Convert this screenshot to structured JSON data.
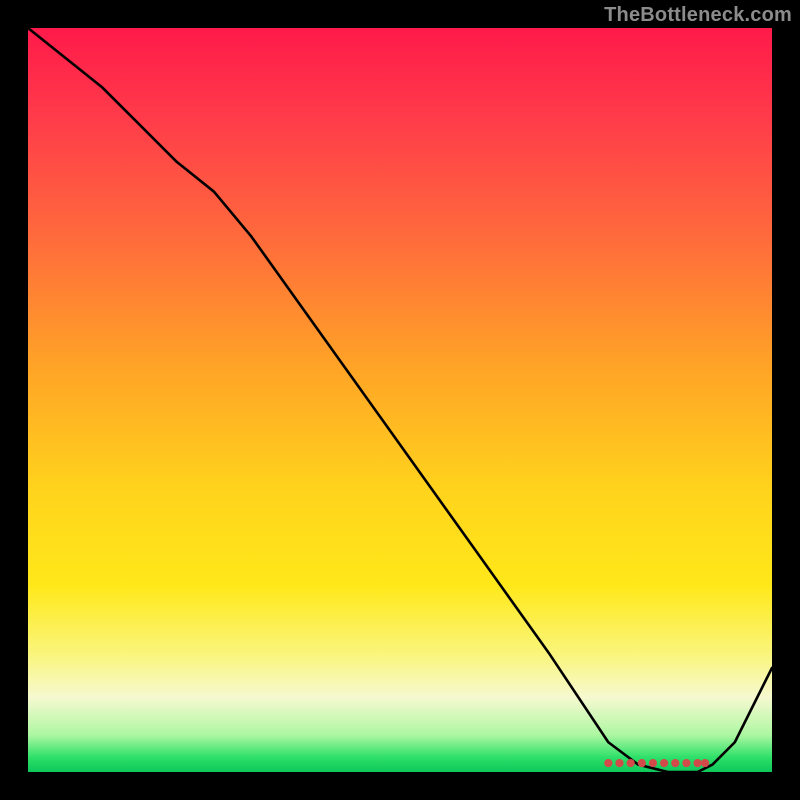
{
  "watermark": "TheBottleneck.com",
  "chart_data": {
    "type": "line",
    "title": "",
    "xlabel": "",
    "ylabel": "",
    "xlim": [
      0,
      100
    ],
    "ylim": [
      0,
      100
    ],
    "grid": false,
    "legend": false,
    "series": [
      {
        "name": "curve",
        "x": [
          0,
          10,
          20,
          25,
          30,
          40,
          50,
          60,
          70,
          78,
          82,
          86,
          90,
          92,
          95,
          100
        ],
        "y": [
          100,
          92,
          82,
          78,
          72,
          58,
          44,
          30,
          16,
          4,
          1,
          0,
          0,
          1,
          4,
          14
        ]
      }
    ],
    "markers": {
      "name": "baseline-dots",
      "x": [
        78,
        79.5,
        81,
        82.5,
        84,
        85.5,
        87,
        88.5,
        90,
        91
      ],
      "y": [
        1.2,
        1.2,
        1.2,
        1.2,
        1.2,
        1.2,
        1.2,
        1.2,
        1.2,
        1.2
      ]
    },
    "colors": {
      "line": "#000000",
      "marker": "#d24a4a",
      "gradient_top": "#ff1a4a",
      "gradient_bottom": "#0cc75a"
    }
  }
}
